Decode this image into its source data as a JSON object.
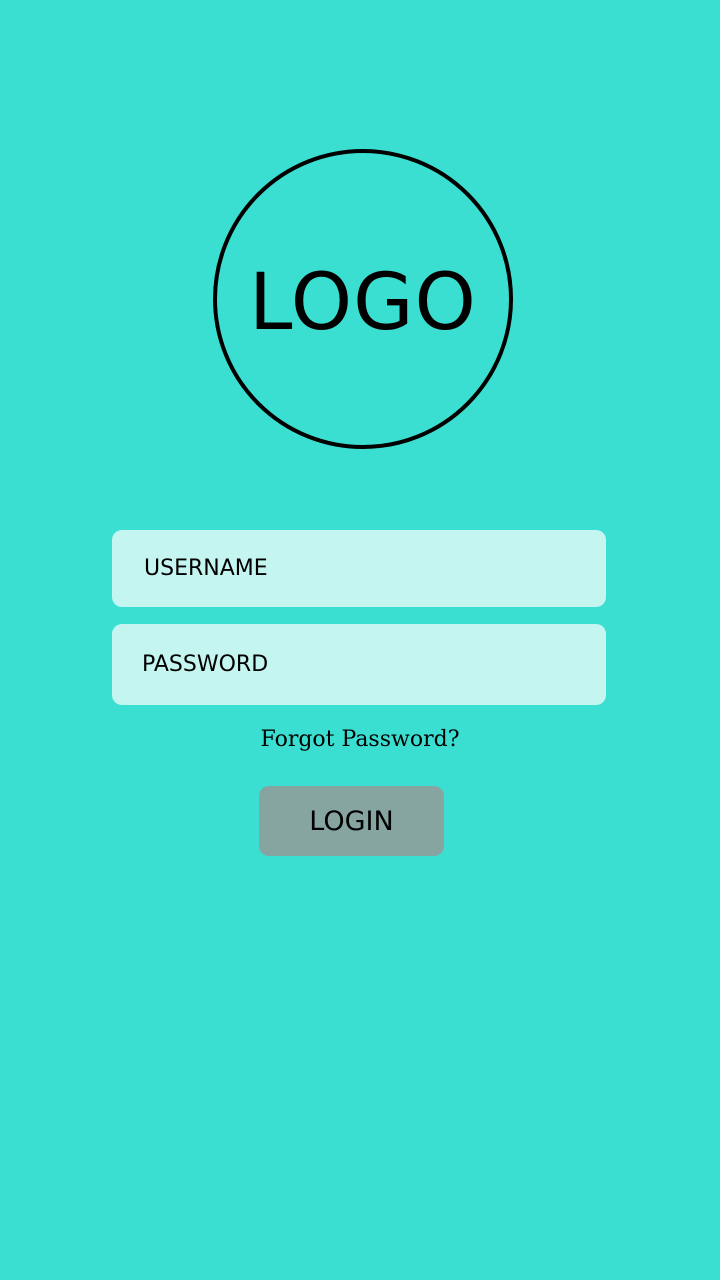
{
  "logo": {
    "text": "LOGO"
  },
  "form": {
    "username_placeholder": "USERNAME",
    "password_placeholder": "PASSWORD",
    "forgot_label": "Forgot Password?",
    "login_label": "LOGIN"
  },
  "colors": {
    "background": "#3BDFD2",
    "input_background": "#C5F5F0",
    "button_background": "#86A5A1",
    "text": "#000000"
  }
}
